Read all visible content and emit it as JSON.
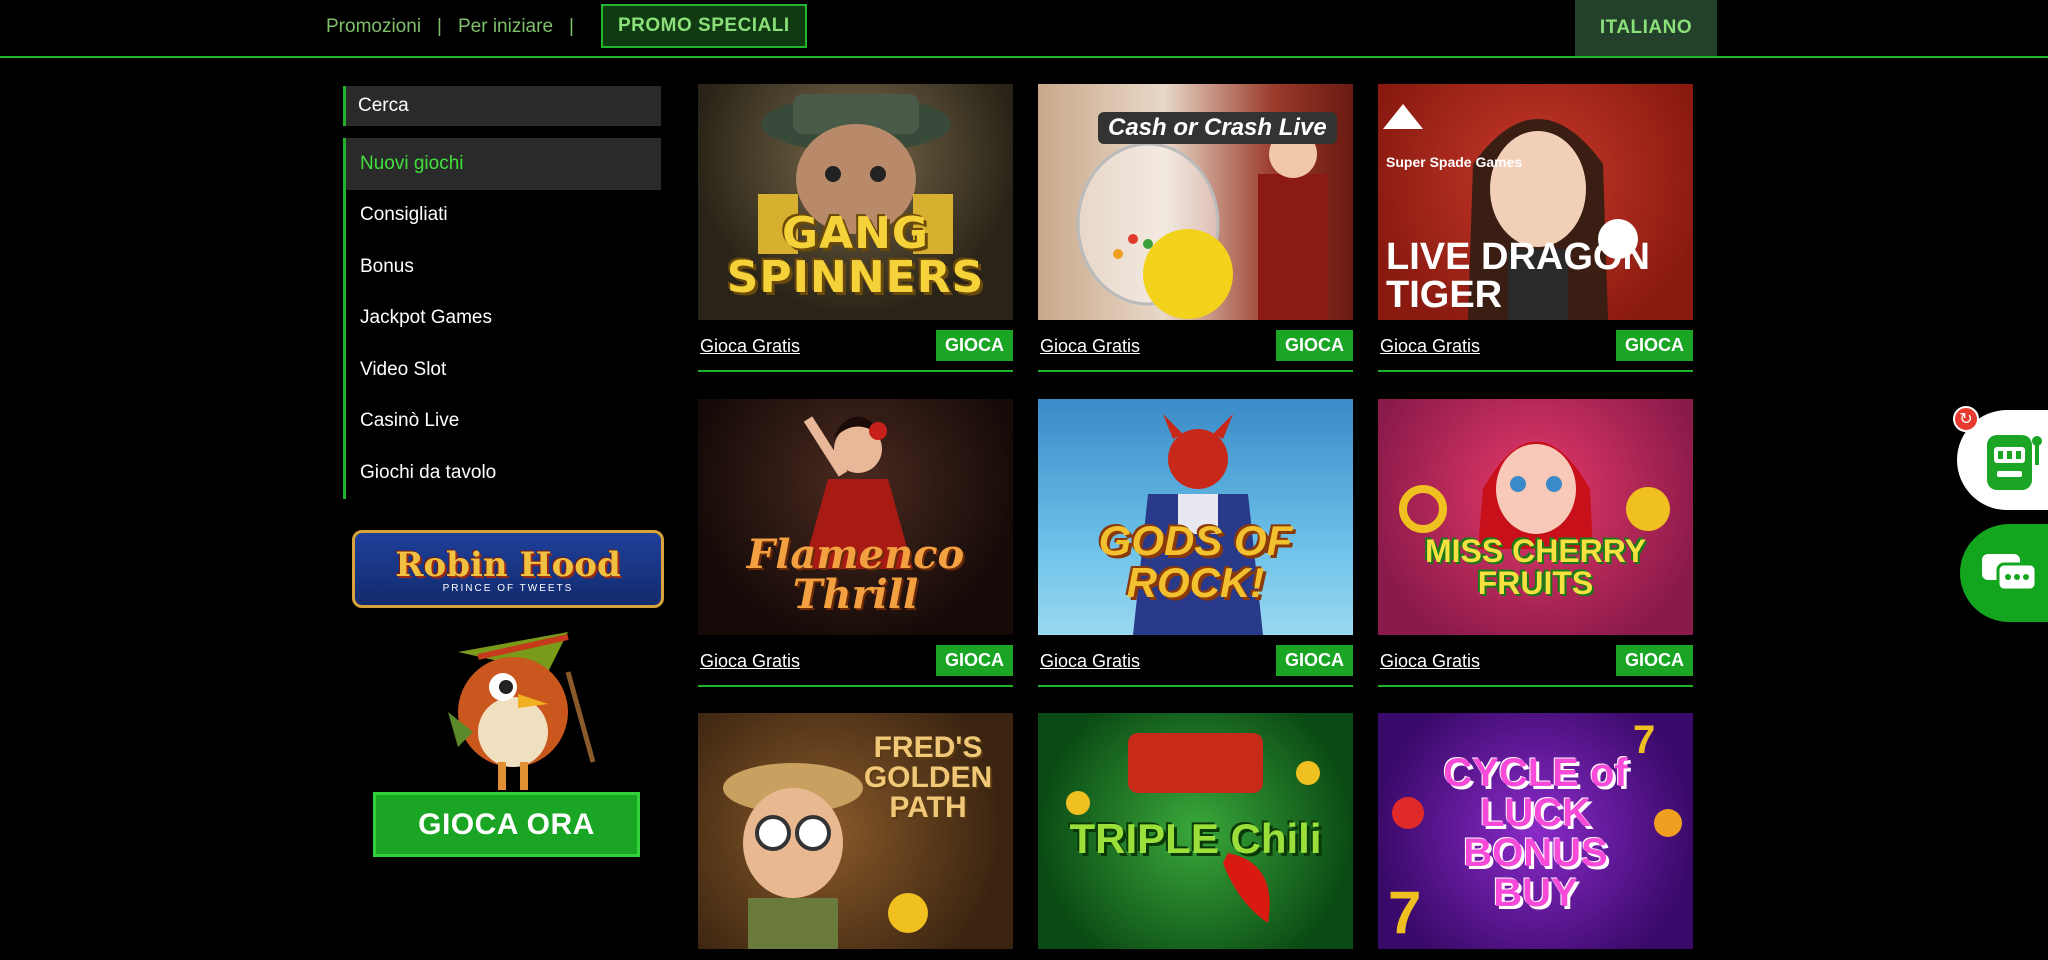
{
  "topbar": {
    "nav": [
      "Promozioni",
      "Per iniziare"
    ],
    "separator": "|",
    "promo_label": "PROMO SPECIALI",
    "language_label": "ITALIANO"
  },
  "sidebar": {
    "search_label": "Cerca",
    "items": [
      {
        "label": "Nuovi giochi",
        "active": true
      },
      {
        "label": "Consigliati"
      },
      {
        "label": "Bonus"
      },
      {
        "label": "Jackpot Games"
      },
      {
        "label": "Video Slot"
      },
      {
        "label": "Casinò Live"
      },
      {
        "label": "Giochi da tavolo"
      }
    ]
  },
  "banner": {
    "logo_title": "Robin Hood",
    "logo_subtitle": "PRINCE OF TWEETS",
    "cta": "GIOCA ORA"
  },
  "games": [
    {
      "title": "GANG SPINNERS",
      "free_label": "Gioca Gratis",
      "play_label": "GIOCA"
    },
    {
      "title": "Cash or Crash Live",
      "free_label": "Gioca Gratis",
      "play_label": "GIOCA"
    },
    {
      "title": "LIVE DRAGON TIGER",
      "brand": "Super Spade Games",
      "free_label": "Gioca Gratis",
      "play_label": "GIOCA"
    },
    {
      "title": "Flamenco Thrill",
      "free_label": "Gioca Gratis",
      "play_label": "GIOCA"
    },
    {
      "title": "GODS OF ROCK!",
      "free_label": "Gioca Gratis",
      "play_label": "GIOCA"
    },
    {
      "title": "MISS CHERRY FRUITS",
      "free_label": "Gioca Gratis",
      "play_label": "GIOCA"
    },
    {
      "title": "FRED'S GOLDEN PATH"
    },
    {
      "title": "TRIPLE Chili"
    },
    {
      "title": "CYCLE of LUCK BONUS BUY"
    }
  ],
  "colors": {
    "accent": "#1fb52a",
    "active_text": "#3fe03a",
    "nav_text": "#7fbf6a"
  },
  "icons": {
    "slot": "slot-machine-icon",
    "chat": "chat-icon",
    "refresh": "refresh-icon"
  }
}
